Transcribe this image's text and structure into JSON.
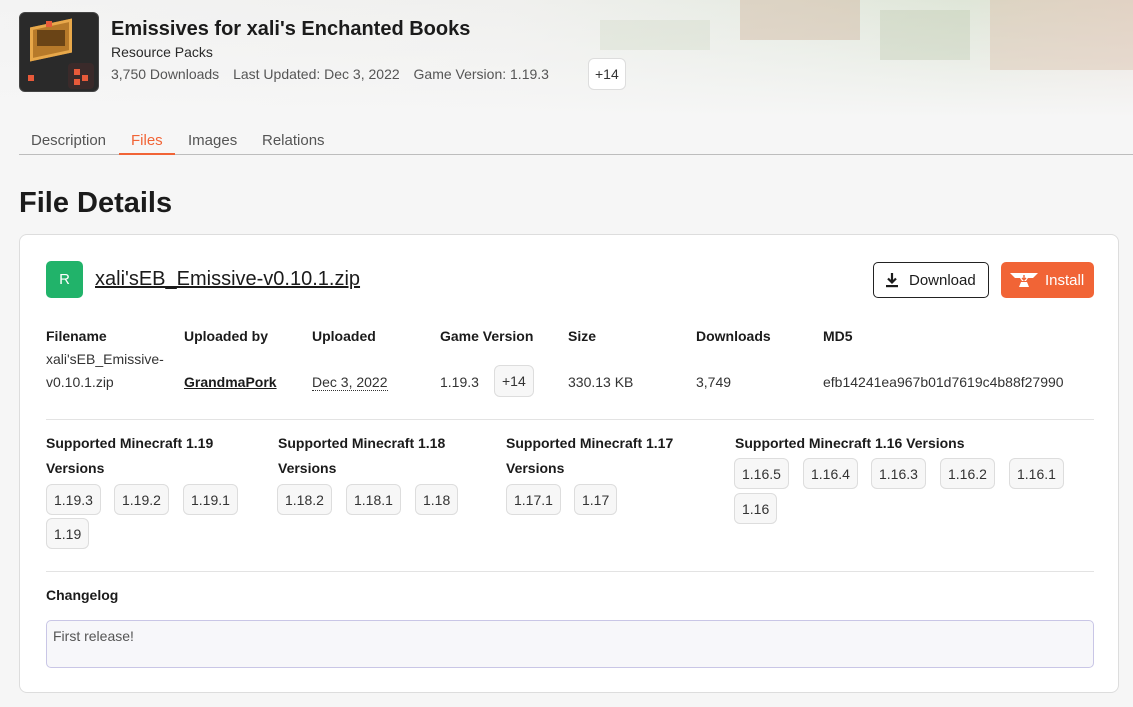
{
  "project": {
    "title": "Emissives for xali's Enchanted Books",
    "category": "Resource Packs",
    "downloads": "3,750 Downloads",
    "last_updated": "Last Updated: Dec 3, 2022",
    "game_version": "Game Version: 1.19.3",
    "more_versions": "+14"
  },
  "tabs": [
    "Description",
    "Files",
    "Images",
    "Relations"
  ],
  "active_tab": "Files",
  "page_title": "File Details",
  "file": {
    "release_type": "R",
    "name": "xali'sEB_Emissive-v0.10.1.zip",
    "download_label": "Download",
    "install_label": "Install",
    "headers": {
      "filename": "Filename",
      "uploaded_by": "Uploaded by",
      "uploaded": "Uploaded",
      "game_version": "Game Version",
      "size": "Size",
      "downloads": "Downloads",
      "md5": "MD5"
    },
    "filename_line1": "xali'sEB_Emissive-",
    "filename_line2": "v0.10.1.zip",
    "uploader": "GrandmaPork",
    "uploaded": "Dec 3, 2022",
    "game_version": "1.19.3",
    "more_versions": "+14",
    "size": "330.13 KB",
    "downloads": "3,749",
    "md5": "efb14241ea967b01d7619c4b88f27990"
  },
  "supported": [
    {
      "title_line1": "Supported Minecraft 1.19",
      "title_line2": "Versions",
      "versions": [
        "1.19.3",
        "1.19.2",
        "1.19.1",
        "1.19"
      ]
    },
    {
      "title_line1": "Supported Minecraft 1.18",
      "title_line2": "Versions",
      "versions": [
        "1.18.2",
        "1.18.1",
        "1.18"
      ]
    },
    {
      "title_line1": "Supported Minecraft 1.17",
      "title_line2": "Versions",
      "versions": [
        "1.17.1",
        "1.17"
      ]
    },
    {
      "title_line1": "Supported Minecraft 1.16 Versions",
      "title_line2": "",
      "versions": [
        "1.16.5",
        "1.16.4",
        "1.16.3",
        "1.16.2",
        "1.16.1",
        "1.16"
      ]
    }
  ],
  "changelog": {
    "title": "Changelog",
    "text": "First release!"
  },
  "colors": {
    "accent": "#f16436",
    "release_green": "#21b36a"
  },
  "icons": [
    "download-icon",
    "anvil-install-icon",
    "project-avatar"
  ]
}
